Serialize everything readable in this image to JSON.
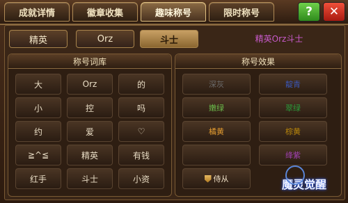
{
  "tabs": [
    {
      "label": "成就详情"
    },
    {
      "label": "徽章收集"
    },
    {
      "label": "趣味称号"
    },
    {
      "label": "限时称号"
    }
  ],
  "buttons": {
    "help": "?",
    "close": "✕"
  },
  "selected": {
    "chips": [
      "精英",
      "Orz",
      "斗士"
    ],
    "preview_text": "精英Orz斗士",
    "preview_color": "#c85acb"
  },
  "vocab_panel": {
    "title": "称号词库",
    "words": [
      "大",
      "Orz",
      "的",
      "小",
      "控",
      "吗",
      "约",
      "爱",
      "♡",
      "≧^≦",
      "精英",
      "有钱",
      "红手",
      "斗士",
      "小资"
    ]
  },
  "effect_panel": {
    "title": "称号效果",
    "effects": [
      {
        "label": "深灰",
        "color": "#6a6a6a"
      },
      {
        "label": "靛青",
        "color": "#3a56b6"
      },
      {
        "label": "嫩绿",
        "color": "#6ab84a"
      },
      {
        "label": "翠绿",
        "color": "#2a9a3a"
      },
      {
        "label": "橘黄",
        "color": "#e09a30"
      },
      {
        "label": "棕黄",
        "color": "#b8860b"
      },
      {
        "label": "",
        "color": "#d83a3a"
      },
      {
        "label": "绛紫",
        "color": "#a040b0"
      },
      {
        "label": "侍从",
        "color": "#f0e2c8"
      }
    ]
  },
  "logo_text": "魔灵觉醒"
}
